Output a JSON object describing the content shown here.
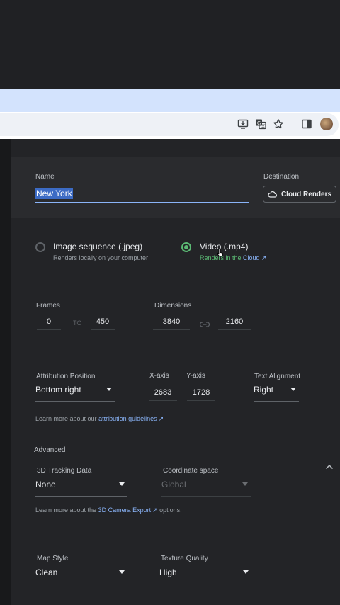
{
  "browser": {
    "icons": [
      "install-app-icon",
      "translate-icon",
      "bookmark-star-icon",
      "side-panel-icon",
      "profile-avatar-icon"
    ]
  },
  "header": {
    "name_label": "Name",
    "name_value": "New York",
    "destination_label": "Destination",
    "destination_button": "Cloud Renders"
  },
  "output": {
    "image_sequence": {
      "title": "Image sequence (.jpeg)",
      "subtitle": "Renders locally on your computer",
      "selected": false
    },
    "video": {
      "title": "Video (.mp4)",
      "subtitle_prefix": "Renders in the ",
      "subtitle_link": "Cloud",
      "selected": true
    }
  },
  "frames": {
    "label": "Frames",
    "from": "0",
    "to_label": "TO",
    "to": "450"
  },
  "dimensions": {
    "label": "Dimensions",
    "width": "3840",
    "height": "2160"
  },
  "attribution": {
    "position_label": "Attribution Position",
    "position_value": "Bottom right",
    "x_label": "X-axis",
    "x_value": "2683",
    "y_label": "Y-axis",
    "y_value": "1728",
    "align_label": "Text Alignment",
    "align_value": "Right",
    "note_prefix": "Learn more about our ",
    "note_link": "attribution guidelines"
  },
  "advanced": {
    "label": "Advanced",
    "tracking_label": "3D Tracking Data",
    "tracking_value": "None",
    "coord_label": "Coordinate space",
    "coord_value": "Global",
    "note_prefix": "Learn more about the ",
    "note_link": "3D Camera Export",
    "note_suffix": " options."
  },
  "map": {
    "style_label": "Map Style",
    "style_value": "Clean",
    "texture_label": "Texture Quality",
    "texture_value": "High"
  },
  "colors": {
    "accent": "#8ab4f8",
    "radio_on": "#5bb974",
    "selection": "#3c6bc4"
  }
}
